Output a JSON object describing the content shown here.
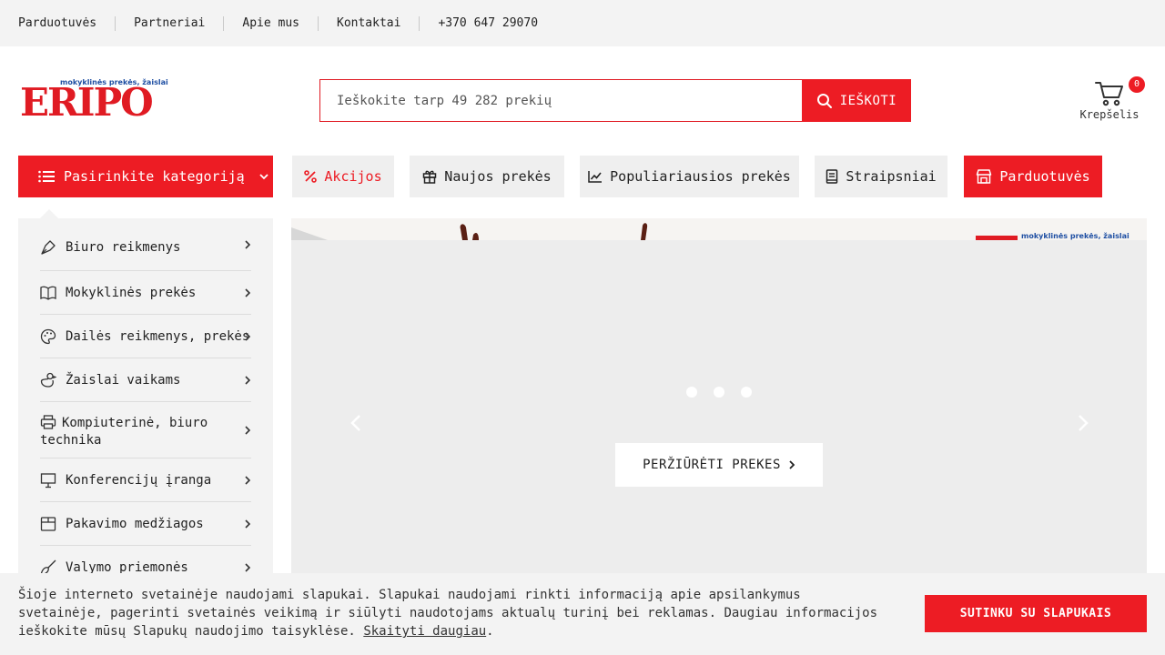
{
  "topbar": {
    "links": [
      "Parduotuvės",
      "Partneriai",
      "Apie mus",
      "Kontaktai"
    ],
    "phone": "+370 647 29070"
  },
  "logo": {
    "wordmark": "ERIPO",
    "tagline": "mokyklinės prekės, žaislai"
  },
  "search": {
    "placeholder": "Ieškokite tarp 49 282 prekių",
    "button_label": "IEŠKOTI"
  },
  "cart": {
    "count": "0",
    "label": "Krepšelis"
  },
  "nav": {
    "category_button": "Pasirinkite kategoriją",
    "links": {
      "sales": "Akcijos",
      "new": "Naujos prekės",
      "popular": "Populiariausios prekės",
      "articles": "Straipsniai",
      "stores": "Parduotuvės"
    }
  },
  "categories": [
    {
      "label": "Biuro reikmenys",
      "icon": "pen-nib-icon"
    },
    {
      "label": "Mokyklinės prekės",
      "icon": "open-book-icon"
    },
    {
      "label": "Dailės reikmenys, prekės",
      "icon": "palette-icon"
    },
    {
      "label": "Žaislai vaikams",
      "icon": "duck-toy-icon"
    },
    {
      "label": "Kompiuterinė, biuro technika",
      "icon": "printer-icon"
    },
    {
      "label": "Konferencijų įranga",
      "icon": "presentation-board-icon"
    },
    {
      "label": "Pakavimo medžiagos",
      "icon": "box-icon"
    },
    {
      "label": "Valymo priemonės",
      "icon": "broom-icon"
    }
  ],
  "slider": {
    "cta_label": "PERŽIŪRĖTI PREKES",
    "slide_count": 3,
    "active_slide": 2,
    "banner_tagline": "mokyklinės prekės, žaislai"
  },
  "cookie": {
    "text": "Šioje interneto svetainėje naudojami slapukai. Slapukai naudojami rinkti informaciją apie apsilankymus svetainėje, pagerinti svetainės veikimą ir siūlyti naudotojams aktualų turinį bei reklamas. Daugiau informacijos ieškokite mūsų Slapukų naudojimo taisyklėse.",
    "link_label": "Skaityti daugiau",
    "link_suffix": ".",
    "accept_label": "SUTINKU SU SLAPUKAIS"
  },
  "colors": {
    "brand_red": "#ed1c24",
    "logo_blue": "#1f4fa3",
    "light_gray": "#f3f3f3"
  }
}
